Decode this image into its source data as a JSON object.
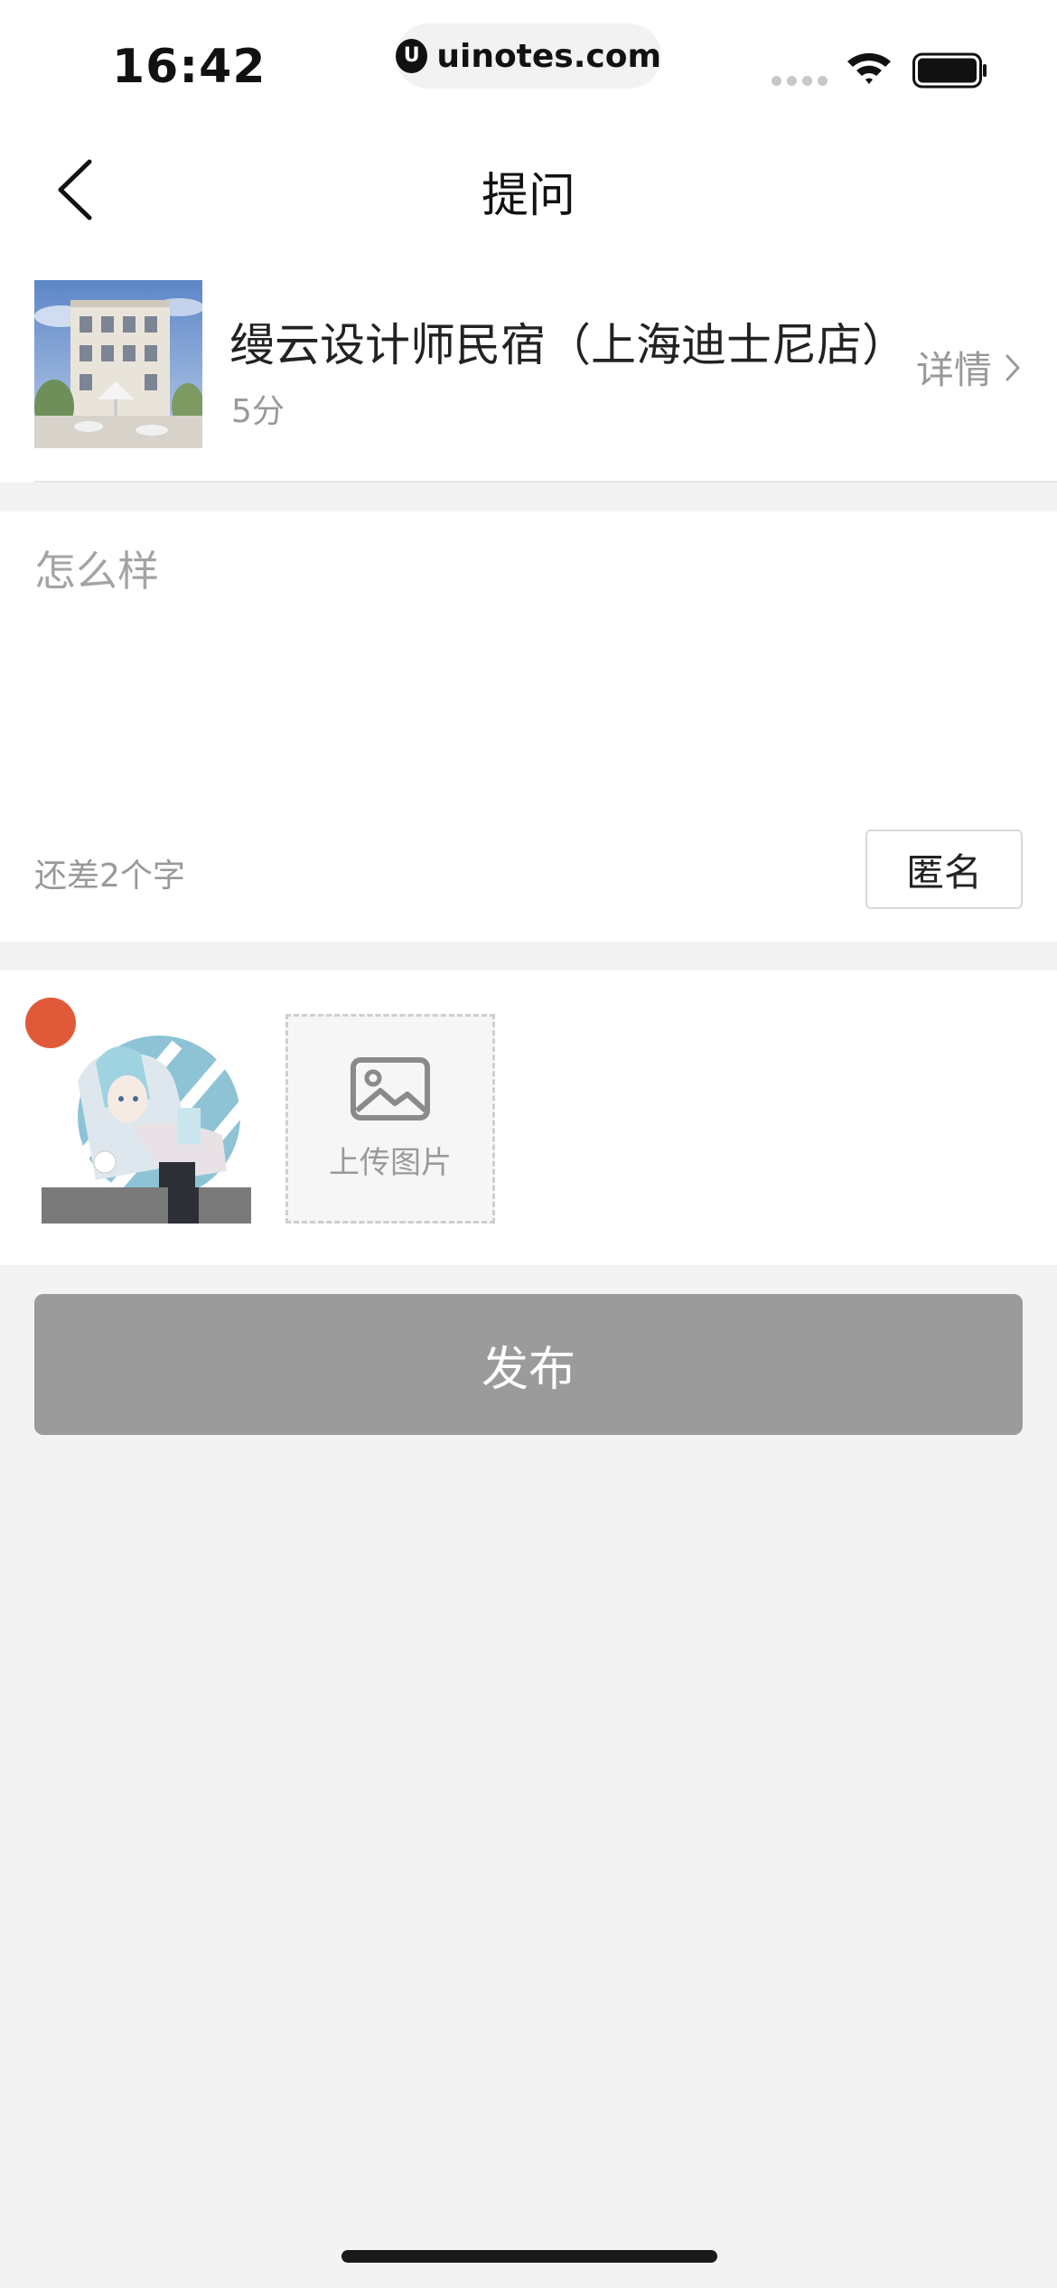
{
  "status_bar": {
    "time": "16:42",
    "url": "uinotes.com",
    "url_logo": "U"
  },
  "navbar": {
    "title": "提问"
  },
  "hotel": {
    "name": "缦云设计师民宿（上海迪士尼店）",
    "score": "5分",
    "detail_label": "详情"
  },
  "question": {
    "placeholder": "怎么样",
    "value": "",
    "hint": "还差2个字",
    "anonymous_label": "匿名"
  },
  "photos": {
    "upload_label": "上传图片",
    "delete_color": "#e05a3a"
  },
  "publish": {
    "label": "发布",
    "color": "#9b9b9b"
  }
}
